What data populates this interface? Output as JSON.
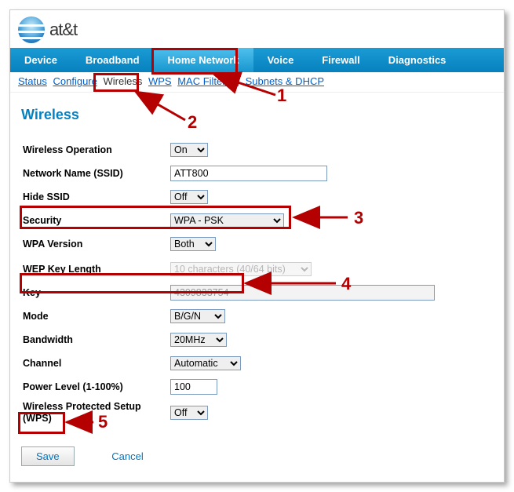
{
  "brand": {
    "name": "at&t"
  },
  "nav": {
    "items": [
      "Device",
      "Broadband",
      "Home Network",
      "Voice",
      "Firewall",
      "Diagnostics"
    ],
    "active_index": 2
  },
  "subnav": {
    "items": [
      "Status",
      "Configure",
      "Wireless",
      "WPS",
      "MAC Filtering",
      "Subnets & DHCP"
    ],
    "active_index": 2
  },
  "page": {
    "title": "Wireless"
  },
  "form": {
    "wireless_operation": {
      "label": "Wireless Operation",
      "value": "On"
    },
    "ssid": {
      "label": "Network Name (SSID)",
      "value": "ATT800"
    },
    "hide_ssid": {
      "label": "Hide SSID",
      "value": "Off"
    },
    "security": {
      "label": "Security",
      "value": "WPA - PSK"
    },
    "wpa_version": {
      "label": "WPA Version",
      "value": "Both"
    },
    "wep_len": {
      "label": "WEP Key Length",
      "value": "10 characters (40/64 bits)"
    },
    "key": {
      "label": "Key",
      "value": "4309833754"
    },
    "mode": {
      "label": "Mode",
      "value": "B/G/N"
    },
    "bandwidth": {
      "label": "Bandwidth",
      "value": "20MHz"
    },
    "channel": {
      "label": "Channel",
      "value": "Automatic"
    },
    "power": {
      "label": "Power Level (1-100%)",
      "value": "100"
    },
    "wps": {
      "label": "Wireless Protected Setup (WPS)",
      "value": "Off"
    }
  },
  "buttons": {
    "save": "Save",
    "cancel": "Cancel"
  },
  "annotations": {
    "n1": "1",
    "n2": "2",
    "n3": "3",
    "n4": "4",
    "n5": "5"
  }
}
